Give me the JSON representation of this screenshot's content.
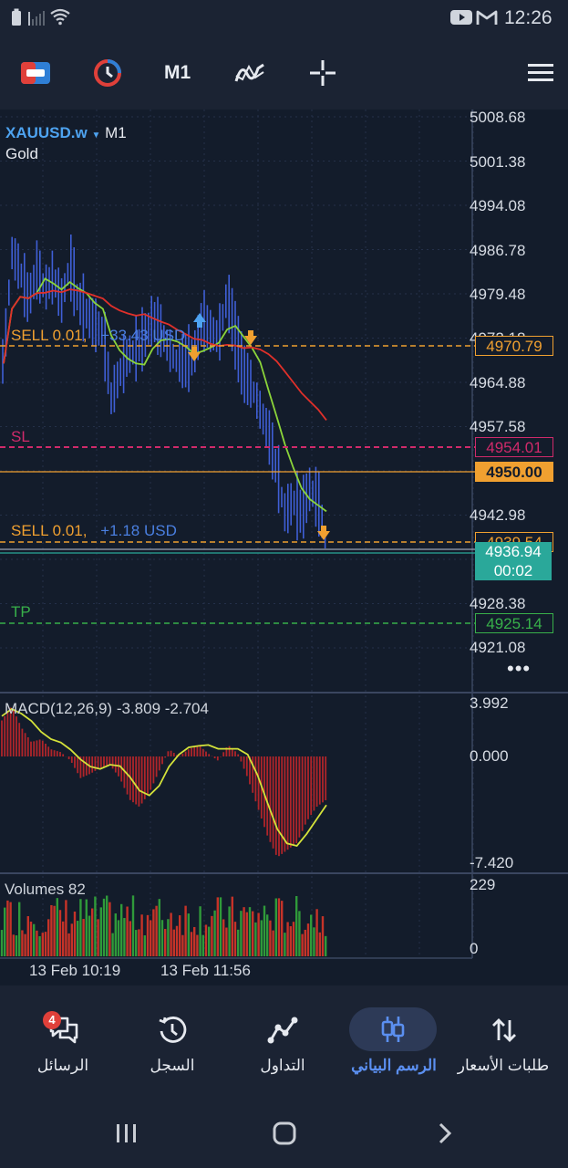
{
  "status_bar": {
    "time": "12:26",
    "icons": [
      "battery-icon",
      "signal-icon",
      "wifi-icon",
      "youtube-icon",
      "gmail-icon"
    ]
  },
  "toolbar": {
    "timeframe": "M1",
    "icons": [
      "switch-chart-icon",
      "history-clock-icon",
      "indicators-icon",
      "crosshair-icon",
      "menu-icon"
    ]
  },
  "chart": {
    "symbol": "XAUUSD.w",
    "timeframe": "M1",
    "description": "Gold",
    "price_scale": [
      "5008.68",
      "5001.38",
      "4994.08",
      "4986.78",
      "4979.48",
      "4964.88",
      "4957.58",
      "4942.98",
      "4928.38",
      "4921.08"
    ],
    "price_scale_partial": "4972.18",
    "sell_order_1": {
      "label": "SELL 0.01,",
      "profit": "+33.43 USD",
      "price": "4970.79"
    },
    "stop_loss": {
      "label": "SL",
      "price": "4954.01"
    },
    "alert_line": {
      "price": "4950.00"
    },
    "sell_order_2": {
      "label": "SELL 0.01,",
      "profit": "+1.18 USD",
      "price": "4939.54"
    },
    "bid": {
      "price": "4936.94",
      "countdown": "00:02"
    },
    "take_profit": {
      "label": "TP",
      "price": "4925.14"
    },
    "more": "•••",
    "colors": {
      "background": "#131c2b",
      "candle": "#3f5fd6",
      "ma_green": "#8bd43a",
      "ma_red": "#e0302a",
      "sell_line": "#f0a030",
      "sl_line": "#d02a6a",
      "tp_line": "#38b04a",
      "bid": "#2aa89a"
    }
  },
  "macd": {
    "label": "MACD(12,26,9) -3.809 -2.704",
    "scale": [
      "3.992",
      "0.000",
      "-7.420"
    ]
  },
  "volumes": {
    "label": "Volumes 82",
    "scale": [
      "229",
      "0"
    ]
  },
  "time_axis": [
    "13 Feb 10:19",
    "13 Feb 11:56"
  ],
  "bottom_nav": {
    "items": [
      {
        "label": "الرسائل",
        "icon": "messages-icon",
        "badge": "4",
        "active": false
      },
      {
        "label": "السجل",
        "icon": "history-icon",
        "active": false
      },
      {
        "label": "التداول",
        "icon": "trade-icon",
        "active": false
      },
      {
        "label": "الرسم البياني",
        "icon": "chart-icon",
        "active": true
      },
      {
        "label": "طلبات الأسعار",
        "icon": "quotes-icon",
        "active": false
      }
    ]
  },
  "system_nav": [
    "recents-icon",
    "home-icon",
    "back-icon"
  ]
}
